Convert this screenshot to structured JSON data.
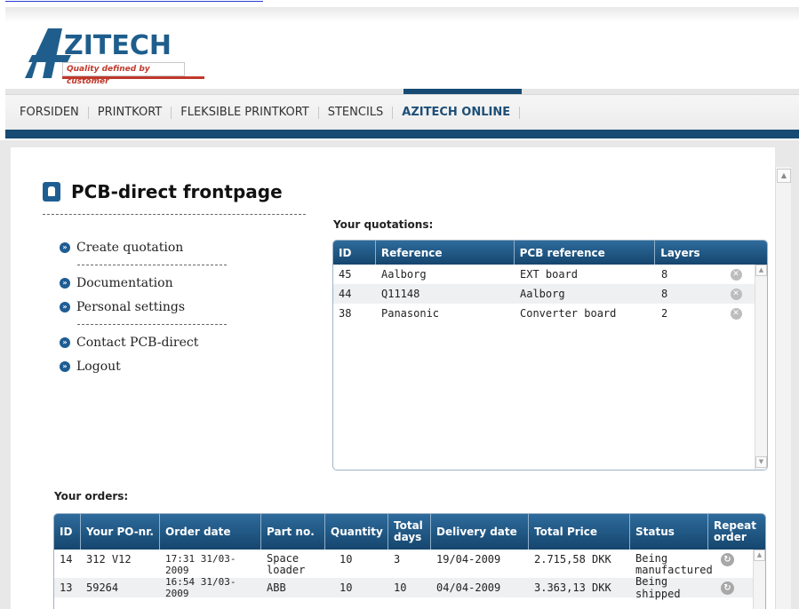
{
  "nav": {
    "items": [
      {
        "label": "FORSIDEN",
        "active": false
      },
      {
        "label": "PRINTKORT",
        "active": false
      },
      {
        "label": "FLEKSIBLE PRINTKORT",
        "active": false
      },
      {
        "label": "STENCILS",
        "active": false
      },
      {
        "label": "AZITECH ONLINE",
        "active": true
      }
    ]
  },
  "logo": {
    "wordmark": "ZITECH",
    "tagline": "Quality defined by customer"
  },
  "page": {
    "title": "PCB-direct frontpage"
  },
  "sidemenu": {
    "create_quotation": "Create quotation",
    "documentation": "Documentation",
    "personal_settings": "Personal settings",
    "contact": "Contact PCB-direct",
    "logout": "Logout"
  },
  "quotations": {
    "label": "Your quotations:",
    "headers": {
      "id": "ID",
      "reference": "Reference",
      "pcb_reference": "PCB reference",
      "layers": "Layers"
    },
    "rows": [
      {
        "id": "45",
        "reference": "Aalborg",
        "pcb_reference": "EXT board",
        "layers": "8"
      },
      {
        "id": "44",
        "reference": "Q11148",
        "pcb_reference": "Aalborg",
        "layers": "8"
      },
      {
        "id": "38",
        "reference": "Panasonic",
        "pcb_reference": "Converter board",
        "layers": "2"
      }
    ]
  },
  "orders": {
    "label": "Your orders:",
    "headers": {
      "id": "ID",
      "po": "Your PO-nr.",
      "order_date": "Order date",
      "part_no": "Part no.",
      "quantity": "Quantity",
      "total_days": "Total days",
      "delivery_date": "Delivery date",
      "total_price": "Total Price",
      "status": "Status",
      "repeat": "Repeat order"
    },
    "rows": [
      {
        "id": "14",
        "po": "312 V12",
        "order_date": "17:31 31/03-2009",
        "part_no": "Space loader",
        "quantity": "10",
        "total_days": "3",
        "delivery_date": "19/04-2009",
        "total_price": "2.715,58 DKK",
        "status": "Being manufactured"
      },
      {
        "id": "13",
        "po": "59264",
        "order_date": "16:54 31/03-2009",
        "part_no": "ABB",
        "quantity": "10",
        "total_days": "10",
        "delivery_date": "04/04-2009",
        "total_price": "3.363,13 DKK",
        "status": "Being shipped"
      }
    ]
  },
  "colors": {
    "brand_blue": "#174b73",
    "header_blue": "#1f5e8c",
    "tagline_red": "#c0392b"
  }
}
